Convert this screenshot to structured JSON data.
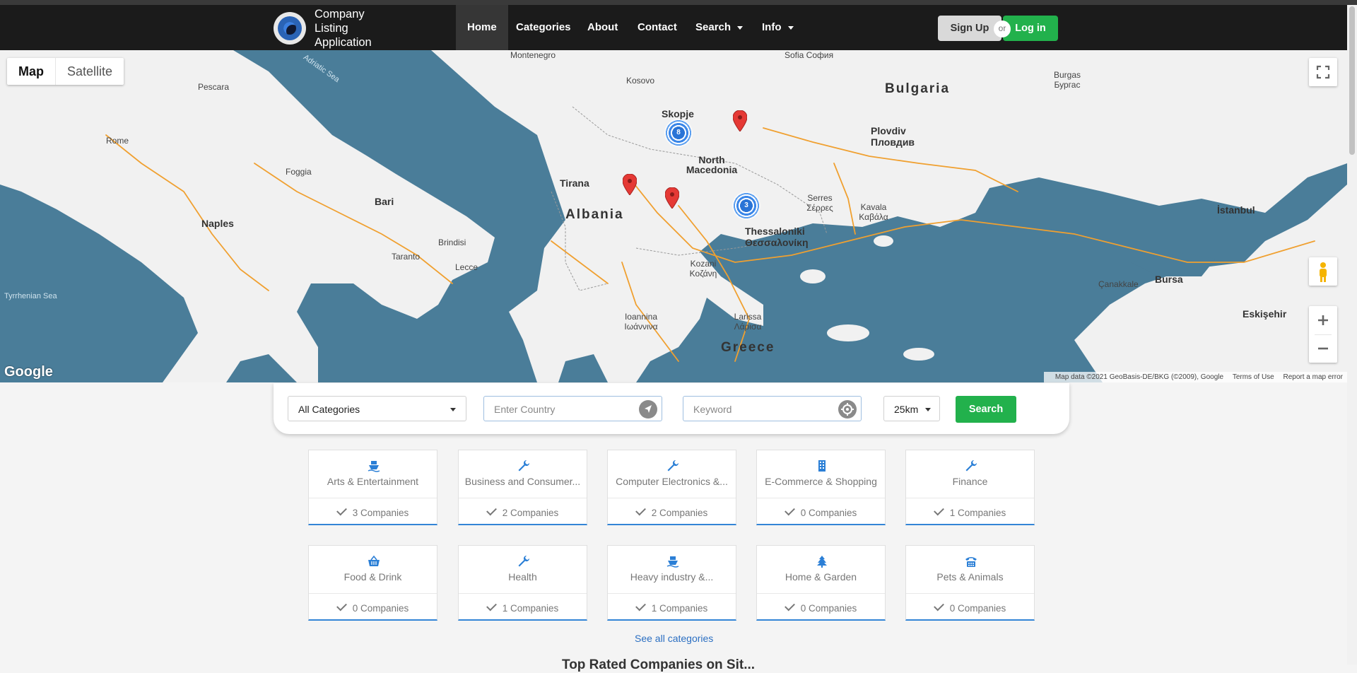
{
  "nav": {
    "brand": "Company Listing Application",
    "items": [
      "Home",
      "Categories",
      "About",
      "Contact",
      "Search",
      "Info"
    ],
    "signup": "Sign Up",
    "or": "or",
    "login": "Log in"
  },
  "map": {
    "type_map": "Map",
    "type_satellite": "Satellite",
    "google": "Google",
    "attribution": "Map data ©2021 GeoBasis-DE/BKG (©2009), Google",
    "terms": "Terms of Use",
    "report": "Report a map error",
    "clusters": [
      "8",
      "3"
    ],
    "labels": {
      "bulgaria": "Bulgaria",
      "albania": "Albania",
      "greece": "Greece",
      "north_macedonia": "North Macedonia",
      "montenegro": "Montenegro",
      "kosovo": "Kosovo",
      "sofia": "Sofia София",
      "skopje": "Skopje",
      "tirana": "Tirana",
      "thessaloniki": "Thessaloniki Θεσσαλονίκη",
      "plovdiv": "Plovdiv Пловдив",
      "rome": "Rome",
      "naples": "Naples",
      "bari": "Bari",
      "istanbul": "İstanbul",
      "bursa": "Bursa",
      "eskisehir": "Eskişehir",
      "larissa": "Larissa Λάρισα",
      "ioannina": "Ioannina Ιωάννινα",
      "kavala": "Kavala Καβάλα",
      "burgas": "Burgas Бургас",
      "pescara": "Pescara",
      "foggia": "Foggia",
      "taranto": "Taranto",
      "lecce": "Lecce",
      "brindisi": "Brindisi",
      "adriatic": "Adriatic Sea",
      "tyrrhenian": "Tyrrhenian Sea",
      "canakkale": "Çanakkale",
      "kozani": "Kozani Κοζάνη",
      "serres": "Serres Σέρρες"
    }
  },
  "search": {
    "category": "All Categories",
    "country_placeholder": "Enter Country",
    "keyword_placeholder": "Keyword",
    "radius": "25km",
    "button": "Search"
  },
  "categories": [
    {
      "name": "Arts & Entertainment",
      "count": "3 Companies",
      "icon": "ship-icon"
    },
    {
      "name": "Business and Consumer...",
      "count": "2 Companies",
      "icon": "wrench-icon"
    },
    {
      "name": "Computer Electronics &...",
      "count": "2 Companies",
      "icon": "wrench-icon"
    },
    {
      "name": "E-Commerce & Shopping",
      "count": "0 Companies",
      "icon": "building-icon"
    },
    {
      "name": "Finance",
      "count": "1 Companies",
      "icon": "wrench-icon"
    },
    {
      "name": "Food & Drink",
      "count": "0 Companies",
      "icon": "basket-icon"
    },
    {
      "name": "Health",
      "count": "1 Companies",
      "icon": "wrench-icon"
    },
    {
      "name": "Heavy industry &...",
      "count": "1 Companies",
      "icon": "ship-icon"
    },
    {
      "name": "Home & Garden",
      "count": "0 Companies",
      "icon": "tree-icon"
    },
    {
      "name": "Pets & Animals",
      "count": "0 Companies",
      "icon": "phone-icon"
    }
  ],
  "see_all": "See all categories",
  "next_heading": "Top Rated Companies on Sit..."
}
